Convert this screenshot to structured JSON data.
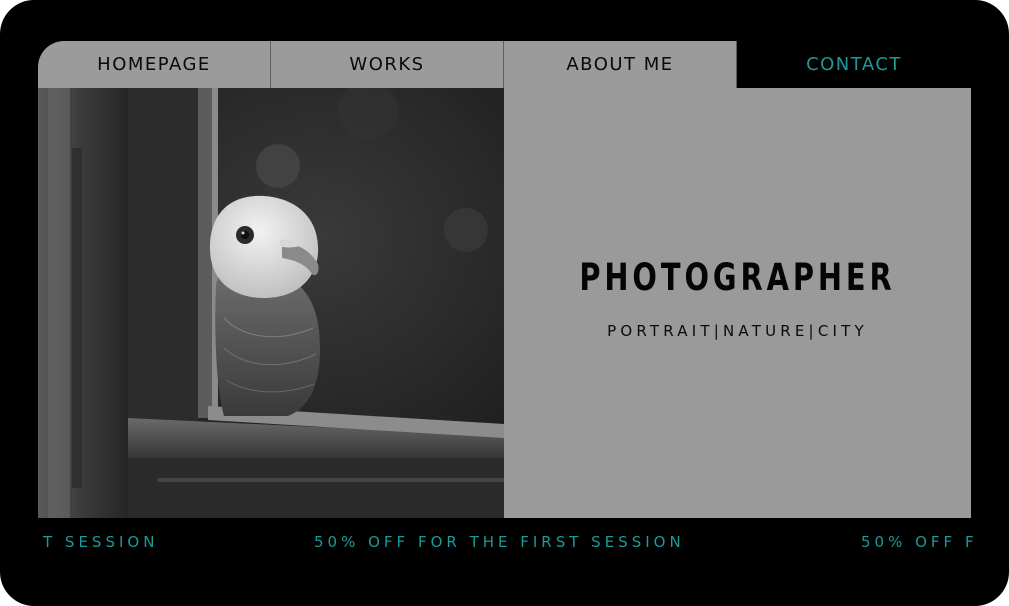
{
  "nav": {
    "items": [
      {
        "label": "HOMEPAGE"
      },
      {
        "label": "WORKS"
      },
      {
        "label": "ABOUT ME"
      },
      {
        "label": "CONTACT"
      }
    ]
  },
  "hero": {
    "title": "PHOTOGRAPHER",
    "subtitle": "PORTRAIT|NATURE|CITY",
    "image": "pigeon-at-window-photo"
  },
  "ticker": {
    "left_fragment": "T SESSION",
    "message": "50% OFF FOR THE FIRST SESSION",
    "right_fragment": "50% OFF F"
  },
  "colors": {
    "frame": "#000000",
    "tab_background": "#9b9b9b",
    "panel_background": "#9a9a9a",
    "accent": "#1a9a98"
  }
}
